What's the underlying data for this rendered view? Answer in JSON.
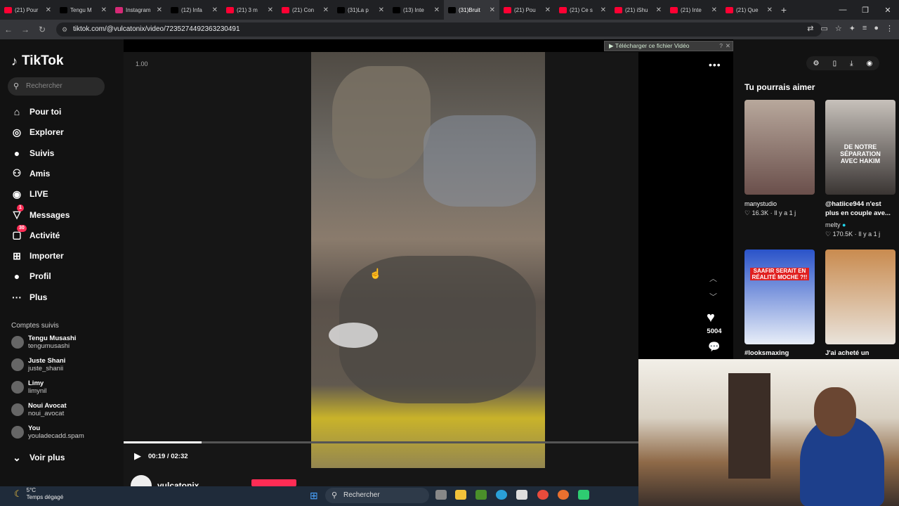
{
  "browser": {
    "tabs": [
      {
        "label": "(21) Pour",
        "color": "#ff0033",
        "active": false
      },
      {
        "label": "Tengu M",
        "color": "#000000",
        "active": false
      },
      {
        "label": "Instagram",
        "color": "#d62976",
        "active": false
      },
      {
        "label": "(12) Infa",
        "color": "#000000",
        "active": false
      },
      {
        "label": "(21) 3 m",
        "color": "#ff0033",
        "active": false
      },
      {
        "label": "(21) Con",
        "color": "#ff0033",
        "active": false
      },
      {
        "label": "(31)La p",
        "color": "#000000",
        "active": false
      },
      {
        "label": "(13) Inte",
        "color": "#000000",
        "active": false
      },
      {
        "label": "(31)Bruit",
        "color": "#000000",
        "active": true
      },
      {
        "label": "(21) Pou",
        "color": "#ff0033",
        "active": false
      },
      {
        "label": "(21) Ce s",
        "color": "#ff0033",
        "active": false
      },
      {
        "label": "(21) iShu",
        "color": "#ff0033",
        "active": false
      },
      {
        "label": "(21) Inte",
        "color": "#ff0033",
        "active": false
      },
      {
        "label": "(21) Que",
        "color": "#ff0033",
        "active": false
      }
    ],
    "url": "tiktok.com/@vulcatonix/video/7235274492363230491"
  },
  "sidebar": {
    "brand": "TikTok",
    "search_placeholder": "Rechercher",
    "nav": [
      {
        "label": "Pour toi",
        "icon": "home-icon",
        "glyph": "⌂",
        "badge": ""
      },
      {
        "label": "Explorer",
        "icon": "compass-icon",
        "glyph": "◎",
        "badge": ""
      },
      {
        "label": "Suivis",
        "icon": "following-avatar-icon",
        "glyph": "●",
        "badge": ""
      },
      {
        "label": "Amis",
        "icon": "friends-icon",
        "glyph": "⚇",
        "badge": ""
      },
      {
        "label": "LIVE",
        "icon": "live-icon",
        "glyph": "◉",
        "badge": ""
      },
      {
        "label": "Messages",
        "icon": "messages-icon",
        "glyph": "▽",
        "badge": "1"
      },
      {
        "label": "Activité",
        "icon": "activity-icon",
        "glyph": "▢",
        "badge": "30"
      },
      {
        "label": "Importer",
        "icon": "upload-icon",
        "glyph": "⊞",
        "badge": ""
      },
      {
        "label": "Profil",
        "icon": "profile-icon",
        "glyph": "●",
        "badge": ""
      },
      {
        "label": "Plus",
        "icon": "more-icon",
        "glyph": "···",
        "badge": ""
      }
    ],
    "following_title": "Comptes suivis",
    "following": [
      {
        "name": "Tengu Musashi",
        "handle": "tengumusashi"
      },
      {
        "name": "Juste Shani",
        "handle": "juste_shanii"
      },
      {
        "name": "Limy",
        "handle": "limynil"
      },
      {
        "name": "Noui Avocat",
        "handle": "noui_avocat"
      },
      {
        "name": "You",
        "handle": "youladecadd.spam"
      }
    ],
    "see_more": "Voir plus"
  },
  "player": {
    "speed": "1.00",
    "download_banner": "Télécharger ce fichier Vidéo",
    "progress_fraction": 0.152,
    "time": "00:19 / 02:32",
    "likes": "5004",
    "author": "vulcatonix"
  },
  "recommend": {
    "title": "Tu pourrais aimer",
    "cards": [
      {
        "title": "manystudio",
        "stat": "16.3K · Il y a 1 j",
        "sub": "",
        "thumb_text": ""
      },
      {
        "title": "@hatiice944 n'est plus en couple ave...",
        "stat": "170.5K · Il y a 1 j",
        "sub": "melty",
        "thumb_text": "DE NOTRE SÉPARATION AVEC HAKIM"
      },
      {
        "title": "#looksmaxing",
        "stat": "",
        "sub": "",
        "thumb_text": "SAAFIR SERAIT EN RÉALITÉ MOCHE ?!!"
      },
      {
        "title": "J'ai acheté un",
        "stat": "",
        "sub": "",
        "thumb_text": ""
      }
    ]
  },
  "taskbar": {
    "temp": "5°C",
    "weather": "Temps dégagé",
    "search": "Rechercher"
  }
}
